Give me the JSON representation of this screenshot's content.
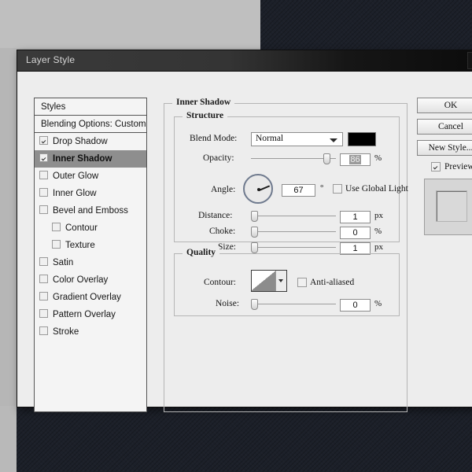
{
  "window": {
    "title": "Layer Style",
    "close_icon": "close-icon"
  },
  "styles_panel": {
    "header": "Styles",
    "blending_options": "Blending Options: Custom",
    "items": [
      {
        "label": "Drop Shadow",
        "checked": true,
        "selected": false,
        "indent": false
      },
      {
        "label": "Inner Shadow",
        "checked": true,
        "selected": true,
        "indent": false
      },
      {
        "label": "Outer Glow",
        "checked": false,
        "selected": false,
        "indent": false
      },
      {
        "label": "Inner Glow",
        "checked": false,
        "selected": false,
        "indent": false
      },
      {
        "label": "Bevel and Emboss",
        "checked": false,
        "selected": false,
        "indent": false
      },
      {
        "label": "Contour",
        "checked": false,
        "selected": false,
        "indent": true
      },
      {
        "label": "Texture",
        "checked": false,
        "selected": false,
        "indent": true
      },
      {
        "label": "Satin",
        "checked": false,
        "selected": false,
        "indent": false
      },
      {
        "label": "Color Overlay",
        "checked": false,
        "selected": false,
        "indent": false
      },
      {
        "label": "Gradient Overlay",
        "checked": false,
        "selected": false,
        "indent": false
      },
      {
        "label": "Pattern Overlay",
        "checked": false,
        "selected": false,
        "indent": false
      },
      {
        "label": "Stroke",
        "checked": false,
        "selected": false,
        "indent": false
      }
    ]
  },
  "main": {
    "section_title": "Inner Shadow",
    "structure": {
      "title": "Structure",
      "blend_mode_label": "Blend Mode:",
      "blend_mode_value": "Normal",
      "color_swatch": "#000000",
      "opacity_label": "Opacity:",
      "opacity_value": "86",
      "opacity_unit": "%",
      "angle_label": "Angle:",
      "angle_value": "67",
      "angle_unit": "°",
      "use_global_light_label": "Use Global Light",
      "use_global_light_checked": false,
      "distance_label": "Distance:",
      "distance_value": "1",
      "distance_unit": "px",
      "choke_label": "Choke:",
      "choke_value": "0",
      "choke_unit": "%",
      "size_label": "Size:",
      "size_value": "1",
      "size_unit": "px"
    },
    "quality": {
      "title": "Quality",
      "contour_label": "Contour:",
      "anti_aliased_label": "Anti-aliased",
      "anti_aliased_checked": false,
      "noise_label": "Noise:",
      "noise_value": "0",
      "noise_unit": "%"
    }
  },
  "buttons": {
    "ok": "OK",
    "cancel": "Cancel",
    "new_style": "New Style...",
    "preview_label": "Preview",
    "preview_checked": true
  }
}
